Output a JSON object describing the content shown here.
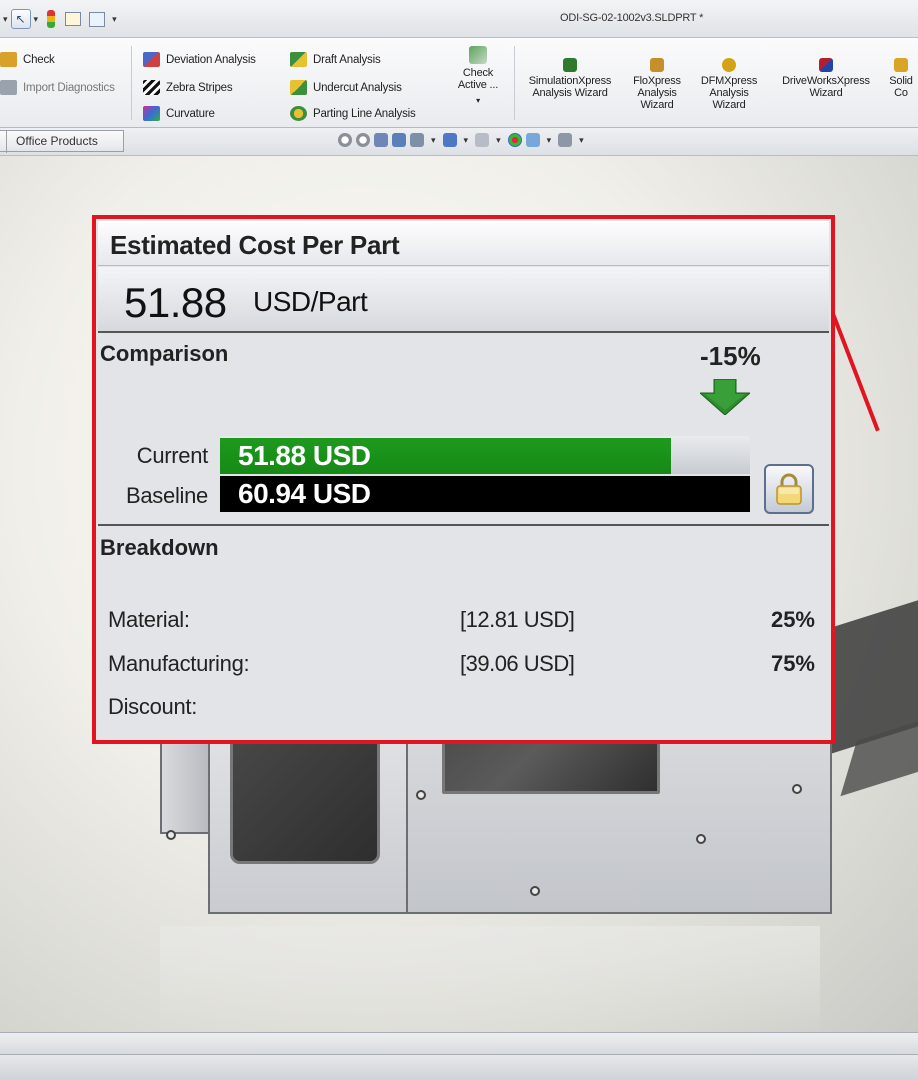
{
  "window": {
    "document_title": "ODI-SG-02-1002v3.SLDPRT *"
  },
  "ribbon": {
    "col1": [
      {
        "label": "Check",
        "icon": "check-icon",
        "color": "#d8a12a"
      },
      {
        "label": "Import Diagnostics",
        "icon": "import-diagnostics-icon",
        "color": "#9aa3ad"
      }
    ],
    "col2": [
      {
        "label": "Deviation Analysis",
        "icon": "deviation-analysis-icon",
        "color": "#4b67c9"
      },
      {
        "label": "Zebra Stripes",
        "icon": "zebra-stripes-icon",
        "color": "#111111"
      },
      {
        "label": "Curvature",
        "icon": "curvature-icon",
        "color": "#c4339a"
      }
    ],
    "col3": [
      {
        "label": "Draft Analysis",
        "icon": "draft-analysis-icon",
        "color": "#3c8f3c"
      },
      {
        "label": "Undercut Analysis",
        "icon": "undercut-analysis-icon",
        "color": "#3c8f3c"
      },
      {
        "label": "Parting Line Analysis",
        "icon": "parting-line-analysis-icon",
        "color": "#c9a227"
      }
    ],
    "check_active": "Check Active ...",
    "wizards": [
      {
        "label": "SimulationXpress Analysis Wizard",
        "icon": "simulationxpress-icon",
        "color": "#2f7a2f"
      },
      {
        "label": "FloXpress Analysis Wizard",
        "icon": "floxpress-icon",
        "color": "#c58f2a"
      },
      {
        "label": "DFMXpress Analysis Wizard",
        "icon": "dfmxpress-icon",
        "color": "#d4a315"
      },
      {
        "label": "DriveWorksXpress Wizard",
        "icon": "driveworksxpress-icon",
        "color": "#b51e2e"
      },
      {
        "label": "Solid Co",
        "icon": "solidworks-icon",
        "color": "#d9a526"
      }
    ]
  },
  "tabs": {
    "office_products": "Office Products"
  },
  "cost_panel": {
    "title": "Estimated Cost Per Part",
    "cost_value": "51.88",
    "cost_unit": "USD/Part",
    "comparison_label": "Comparison",
    "change_percent": "-15%",
    "current_label": "Current",
    "current_value": "51.88 USD",
    "current_fraction": 0.851,
    "baseline_label": "Baseline",
    "baseline_value": "60.94 USD",
    "breakdown_label": "Breakdown",
    "breakdown": [
      {
        "label": "Material:",
        "amount": "[12.81 USD]",
        "percent": "25%"
      },
      {
        "label": "Manufacturing:",
        "amount": "[39.06 USD]",
        "percent": "75%"
      },
      {
        "label": "Discount:",
        "amount": "",
        "percent": ""
      }
    ],
    "accent_color": "#e0151f",
    "current_bar_color": "#158a15"
  }
}
